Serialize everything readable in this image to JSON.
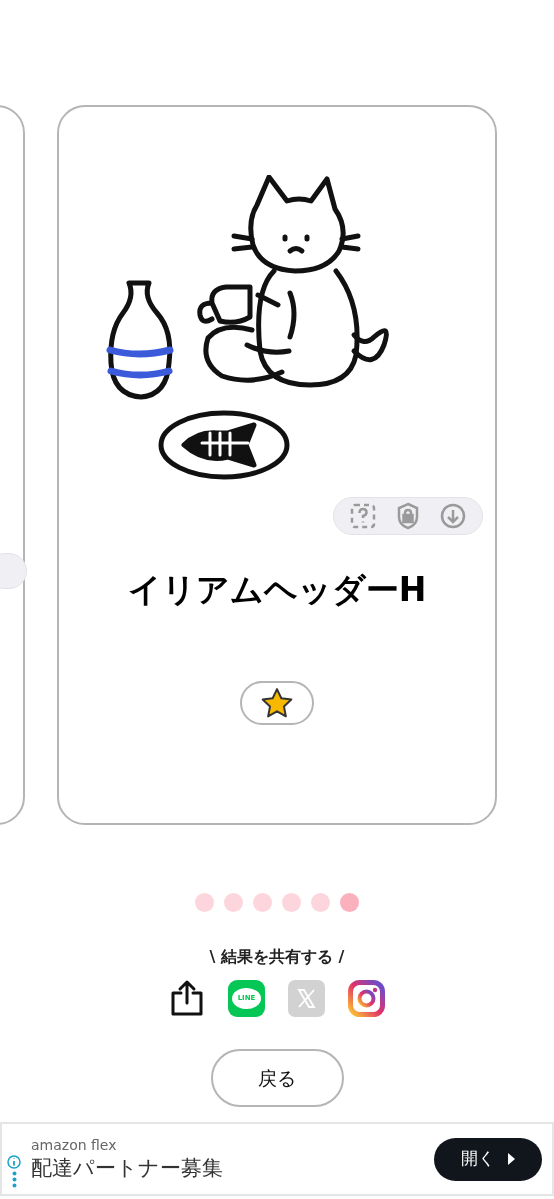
{
  "card": {
    "title": "イリアムヘッダーH",
    "favorite": {
      "selected": true
    }
  },
  "pager": [
    {
      "selected": false
    },
    {
      "selected": false
    },
    {
      "selected": false
    },
    {
      "selected": false
    },
    {
      "selected": false
    },
    {
      "selected": true
    }
  ],
  "share": {
    "label": "\\ 結果を共有する /",
    "line_logo": "LINE"
  },
  "back_button": "戻る",
  "ad": {
    "sponsor": "amazon flex",
    "headline": "配達パートナー募集",
    "button": "開く"
  }
}
